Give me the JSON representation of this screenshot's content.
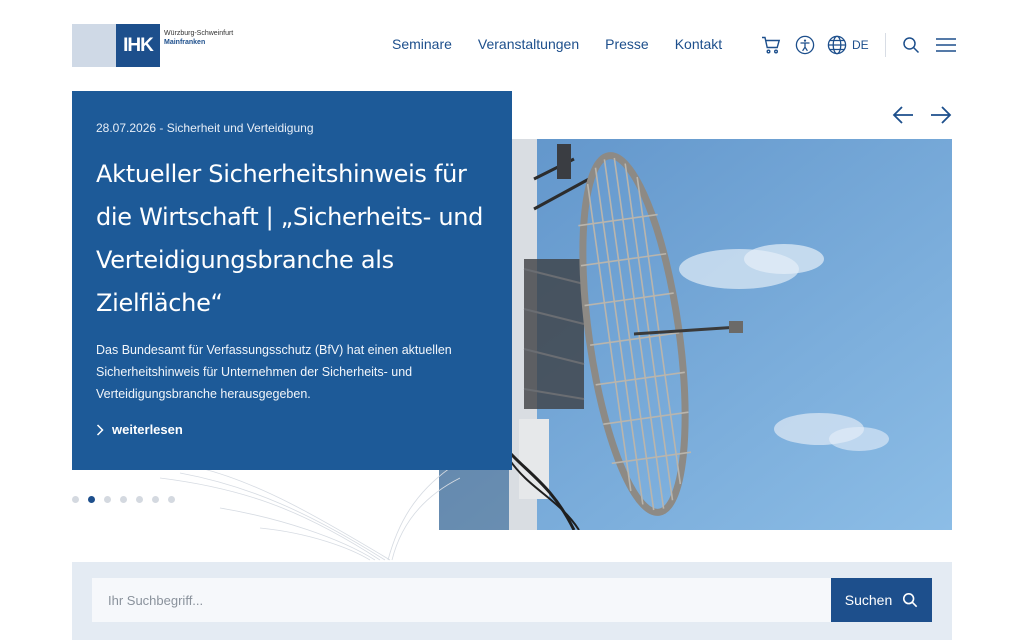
{
  "header": {
    "logo": {
      "mark": "IHK",
      "line1": "Würzburg-Schweinfurt",
      "line2": "Mainfranken"
    },
    "nav": [
      {
        "label": "Seminare"
      },
      {
        "label": "Veranstaltungen"
      },
      {
        "label": "Presse"
      },
      {
        "label": "Kontakt"
      }
    ],
    "utilities": {
      "cart_icon": "cart-icon",
      "accessibility_icon": "accessibility-icon",
      "globe_icon": "globe-icon",
      "language": "DE",
      "search_icon": "search-icon",
      "menu_icon": "hamburger-menu-icon"
    }
  },
  "hero": {
    "meta": "28.07.2026 - Sicherheit und Verteidigung",
    "title": "Aktueller Sicherheitshinweis für die Wirtschaft | „Sicherheits- und Verteidigungsbranche als Zielfläche“",
    "text": "Das Bundesamt für Verfassungsschutz (BfV) hat einen aktuellen Sicherheitshinweis für Unternehmen der Sicherheits- und Verteidigungsbranche herausgegeben.",
    "more_label": "weiterlesen",
    "slides_total": 7,
    "active_slide": 2
  },
  "search": {
    "placeholder": "Ihr Suchbegriff...",
    "button_label": "Suchen"
  },
  "colors": {
    "brand": "#1d4f8c",
    "hero_card": "#1d5a98",
    "search_band": "#e4ebf3"
  }
}
